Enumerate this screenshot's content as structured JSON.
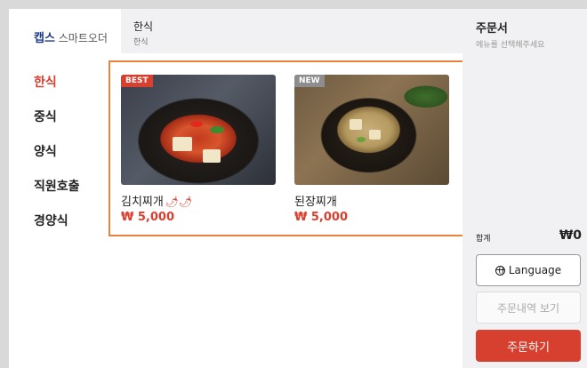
{
  "sidebar": {
    "logo_brand": "캡스",
    "logo_rest": "스마트오더",
    "items": [
      {
        "label": "한식"
      },
      {
        "label": "중식"
      },
      {
        "label": "양식"
      },
      {
        "label": "직원호출"
      },
      {
        "label": "경양식"
      }
    ]
  },
  "header": {
    "title": "한식",
    "subtitle": "한식"
  },
  "menu": {
    "items": [
      {
        "badge": "BEST",
        "name": "김치찌개",
        "price": "₩ 5,000",
        "spicy": "🌶🌶"
      },
      {
        "badge": "NEW",
        "name": "된장찌개",
        "price": "₩ 5,000"
      }
    ]
  },
  "order": {
    "title": "주문서",
    "hint": "메뉴를 선택해주세요",
    "total_label": "합계",
    "total_value": "₩0",
    "language_button": "Language",
    "history_button": "주문내역 보기",
    "submit_button": "주문하기"
  },
  "colors": {
    "accent": "#d7402f",
    "highlight_border": "#e8823c",
    "brand": "#1f3c8a"
  }
}
